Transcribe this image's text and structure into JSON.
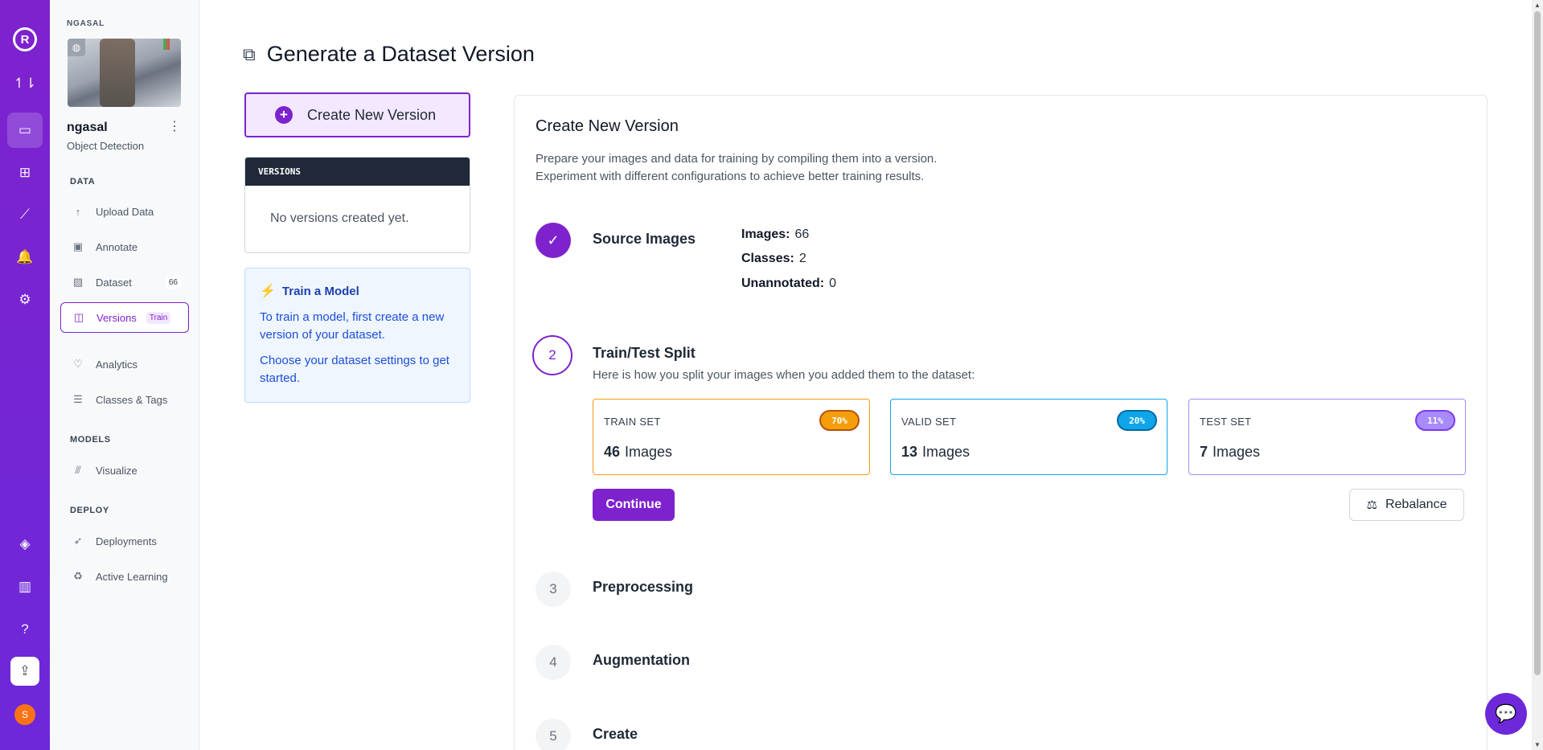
{
  "rail": {
    "logo": "R",
    "items": [
      {
        "icon": "↿⇂",
        "name": "transfer-icon"
      },
      {
        "icon": "▭",
        "name": "inbox-icon"
      },
      {
        "icon": "⊞",
        "name": "workflow-icon"
      },
      {
        "icon": "⟋",
        "name": "chart-icon"
      },
      {
        "icon": "🔔",
        "name": "bell-icon"
      },
      {
        "icon": "⚙",
        "name": "gear-icon"
      },
      {
        "icon": "◈",
        "name": "planet-icon"
      },
      {
        "icon": "▥",
        "name": "library-icon"
      },
      {
        "icon": "?",
        "name": "help-icon"
      },
      {
        "icon": "⇪",
        "name": "upload-icon"
      }
    ],
    "avatar_initial": "S"
  },
  "sidebar": {
    "workspace": "NGASAL",
    "project_name": "ngasal",
    "project_menu": "⋮",
    "project_type": "Object Detection",
    "data_section": "DATA",
    "models_section": "MODELS",
    "deploy_section": "DEPLOY",
    "items": {
      "upload": {
        "label": "Upload Data",
        "icon": "↑"
      },
      "annotate": {
        "label": "Annotate",
        "icon": "▣"
      },
      "dataset": {
        "label": "Dataset",
        "icon": "▨",
        "badge": "66"
      },
      "versions": {
        "label": "Versions",
        "icon": "◫",
        "badge": "Train"
      },
      "analytics": {
        "label": "Analytics",
        "icon": "♡"
      },
      "classes": {
        "label": "Classes & Tags",
        "icon": "☰"
      },
      "visualize": {
        "label": "Visualize",
        "icon": "⫻"
      },
      "deployments": {
        "label": "Deployments",
        "icon": "➶"
      },
      "active_learning": {
        "label": "Active Learning",
        "icon": "♻"
      }
    }
  },
  "main": {
    "title_icon": "⧉",
    "title": "Generate a Dataset Version",
    "create_button": "Create New Version",
    "create_icon": "+",
    "versions_header": "VERSIONS",
    "versions_empty": "No versions created yet.",
    "train": {
      "icon": "⚡",
      "title": "Train a Model",
      "p1": "To train a model, first create a new version of your dataset.",
      "p2": "Choose your dataset settings to get started."
    }
  },
  "panel": {
    "title": "Create New Version",
    "desc_line1": "Prepare your images and data for training by compiling them into a version.",
    "desc_line2": "Experiment with different configurations to achieve better training results.",
    "steps": {
      "source": {
        "marker": "✓",
        "label": "Source Images"
      },
      "split": {
        "marker": "2",
        "label": "Train/Test Split"
      },
      "preprocessing": {
        "marker": "3",
        "label": "Preprocessing"
      },
      "augmentation": {
        "marker": "4",
        "label": "Augmentation"
      },
      "create": {
        "marker": "5",
        "label": "Create"
      }
    },
    "stats": {
      "images_label": "Images:",
      "images_value": "66",
      "classes_label": "Classes:",
      "classes_value": "2",
      "unannotated_label": "Unannotated:",
      "unannotated_value": "0"
    },
    "split_desc": "Here is how you split your images when you added them to the dataset:",
    "cards": {
      "train": {
        "label": "TRAIN SET",
        "pct": "70%",
        "count": "46",
        "unit": "Images",
        "color": "#f59e0b"
      },
      "valid": {
        "label": "VALID SET",
        "pct": "20%",
        "count": "13",
        "unit": "Images",
        "color": "#0ea5e9"
      },
      "test": {
        "label": "TEST SET",
        "pct": "11%",
        "count": "7",
        "unit": "Images",
        "color": "#a78bfa"
      }
    },
    "continue_label": "Continue",
    "rebalance_label": "Rebalance",
    "rebalance_icon": "⚖"
  },
  "chat_icon": "💬"
}
